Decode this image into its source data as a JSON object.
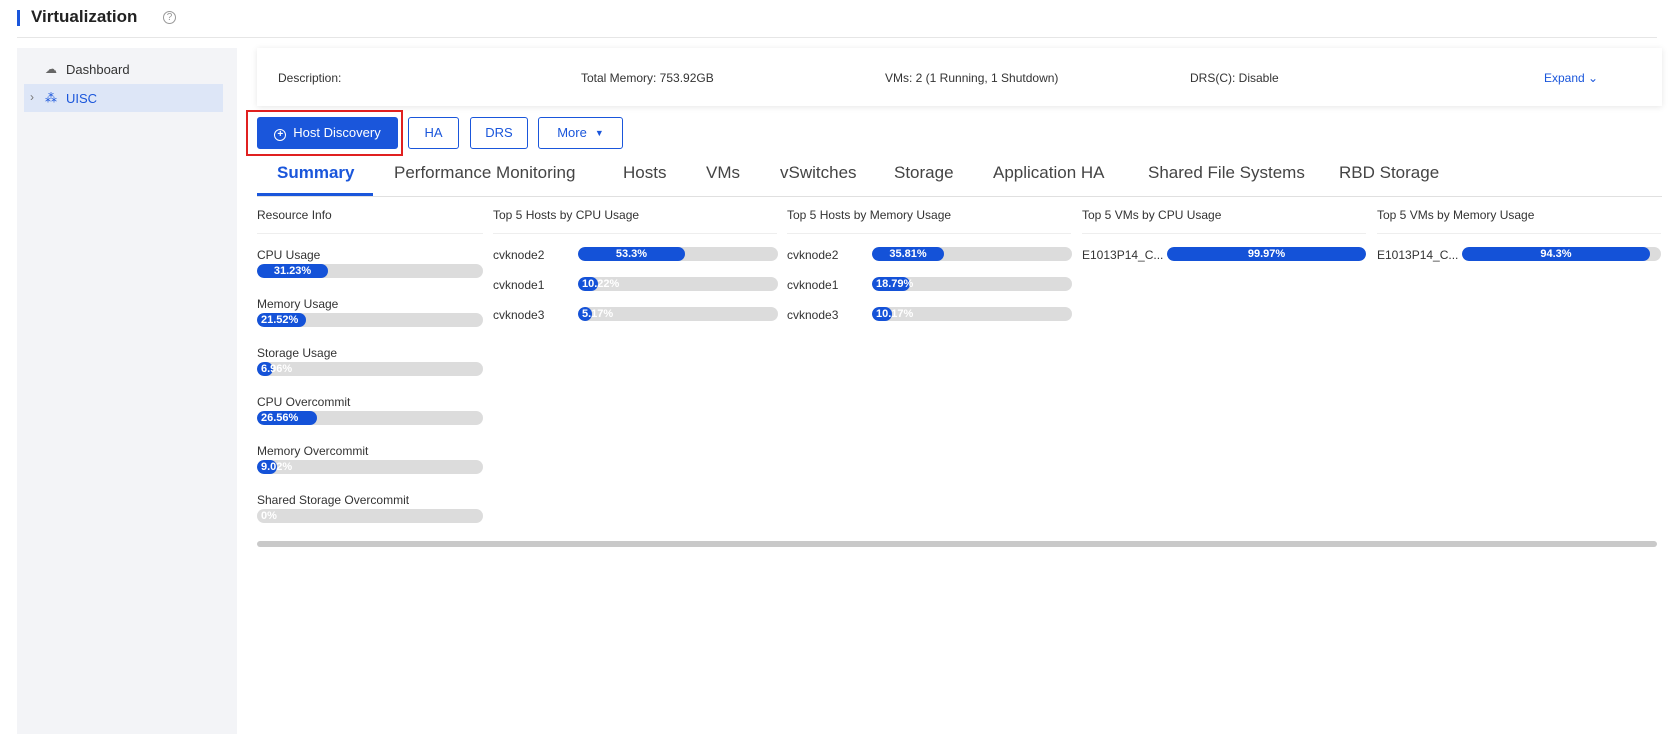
{
  "header": {
    "title": "Virtualization",
    "help_icon": "question-circle-icon"
  },
  "sidebar": {
    "items": [
      {
        "label": "Dashboard",
        "icon": "cloud-icon"
      },
      {
        "label": "UISC",
        "icon": "cluster-icon",
        "expander": "chevron-right-icon"
      }
    ]
  },
  "info": {
    "description_label": "Description:",
    "total_memory": "Total Memory: 753.92GB",
    "vms": "VMs:  2 (1 Running, 1 Shutdown)",
    "drs": "DRS(C): Disable",
    "expand": "Expand"
  },
  "toolbar": {
    "host_discovery": "Host Discovery",
    "ha": "HA",
    "drs": "DRS",
    "more": "More"
  },
  "tabs": [
    "Summary",
    "Performance Monitoring",
    "Hosts",
    "VMs",
    "vSwitches",
    "Storage",
    "Application HA",
    "Shared File Systems",
    "RBD Storage"
  ],
  "summary": {
    "resource_info": {
      "title": "Resource Info",
      "metrics": [
        {
          "label": "CPU Usage",
          "value": 31.23,
          "text": "31.23%"
        },
        {
          "label": "Memory Usage",
          "value": 21.52,
          "text": "21.52%"
        },
        {
          "label": "Storage Usage",
          "value": 6.96,
          "text": "6.96%"
        },
        {
          "label": "CPU Overcommit",
          "value": 26.56,
          "text": "26.56%"
        },
        {
          "label": "Memory Overcommit",
          "value": 9.02,
          "text": "9.02%"
        },
        {
          "label": "Shared Storage Overcommit",
          "value": 0,
          "text": "0%"
        }
      ]
    },
    "top_hosts_cpu": {
      "title": "Top 5 Hosts by CPU Usage",
      "rows": [
        {
          "name": "cvknode2",
          "value": 53.3,
          "text": "53.3%"
        },
        {
          "name": "cvknode1",
          "value": 10.22,
          "text": "10.22%"
        },
        {
          "name": "cvknode3",
          "value": 5.17,
          "text": "5.17%"
        }
      ]
    },
    "top_hosts_mem": {
      "title": "Top 5 Hosts by Memory Usage",
      "rows": [
        {
          "name": "cvknode2",
          "value": 35.81,
          "text": "35.81%"
        },
        {
          "name": "cvknode1",
          "value": 18.79,
          "text": "18.79%"
        },
        {
          "name": "cvknode3",
          "value": 10.17,
          "text": "10.17%"
        }
      ]
    },
    "top_vms_cpu": {
      "title": "Top 5 VMs by CPU Usage",
      "rows": [
        {
          "name": "E1013P14_C...",
          "value": 99.97,
          "text": "99.97%"
        }
      ]
    },
    "top_vms_mem": {
      "title": "Top 5 VMs by Memory Usage",
      "rows": [
        {
          "name": "E1013P14_C...",
          "value": 94.3,
          "text": "94.3%"
        }
      ]
    }
  },
  "colors": {
    "accent": "#1a56db",
    "bar_fill": "#1452d8",
    "bar_track": "#dcdcdc",
    "highlight": "#e02020"
  }
}
